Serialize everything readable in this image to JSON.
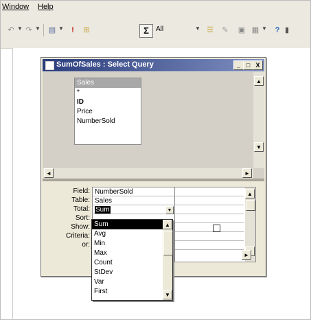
{
  "menu": [
    "Window",
    "Help"
  ],
  "toolbar": {
    "totals_button": "Σ",
    "top_values": "All"
  },
  "query_window": {
    "title": "SumOfSales : Select Query",
    "controls": {
      "minimize": "_",
      "maximize": "□",
      "close": "X"
    }
  },
  "table_box": {
    "title": "Sales",
    "fields": [
      "*",
      "ID",
      "Price",
      "NumberSold"
    ]
  },
  "design_grid": {
    "row_labels": [
      "Field:",
      "Table:",
      "Total:",
      "Sort:",
      "Show:",
      "Criteria:",
      "or:"
    ],
    "field": "NumberSold",
    "table": "Sales",
    "total": "Sum"
  },
  "total_dropdown": {
    "selected": "Sum",
    "options": [
      "Sum",
      "Avg",
      "Min",
      "Max",
      "Count",
      "StDev",
      "Var",
      "First"
    ]
  },
  "scroll_arrows": {
    "up": "▲",
    "down": "▼",
    "left": "◄",
    "right": "►"
  }
}
